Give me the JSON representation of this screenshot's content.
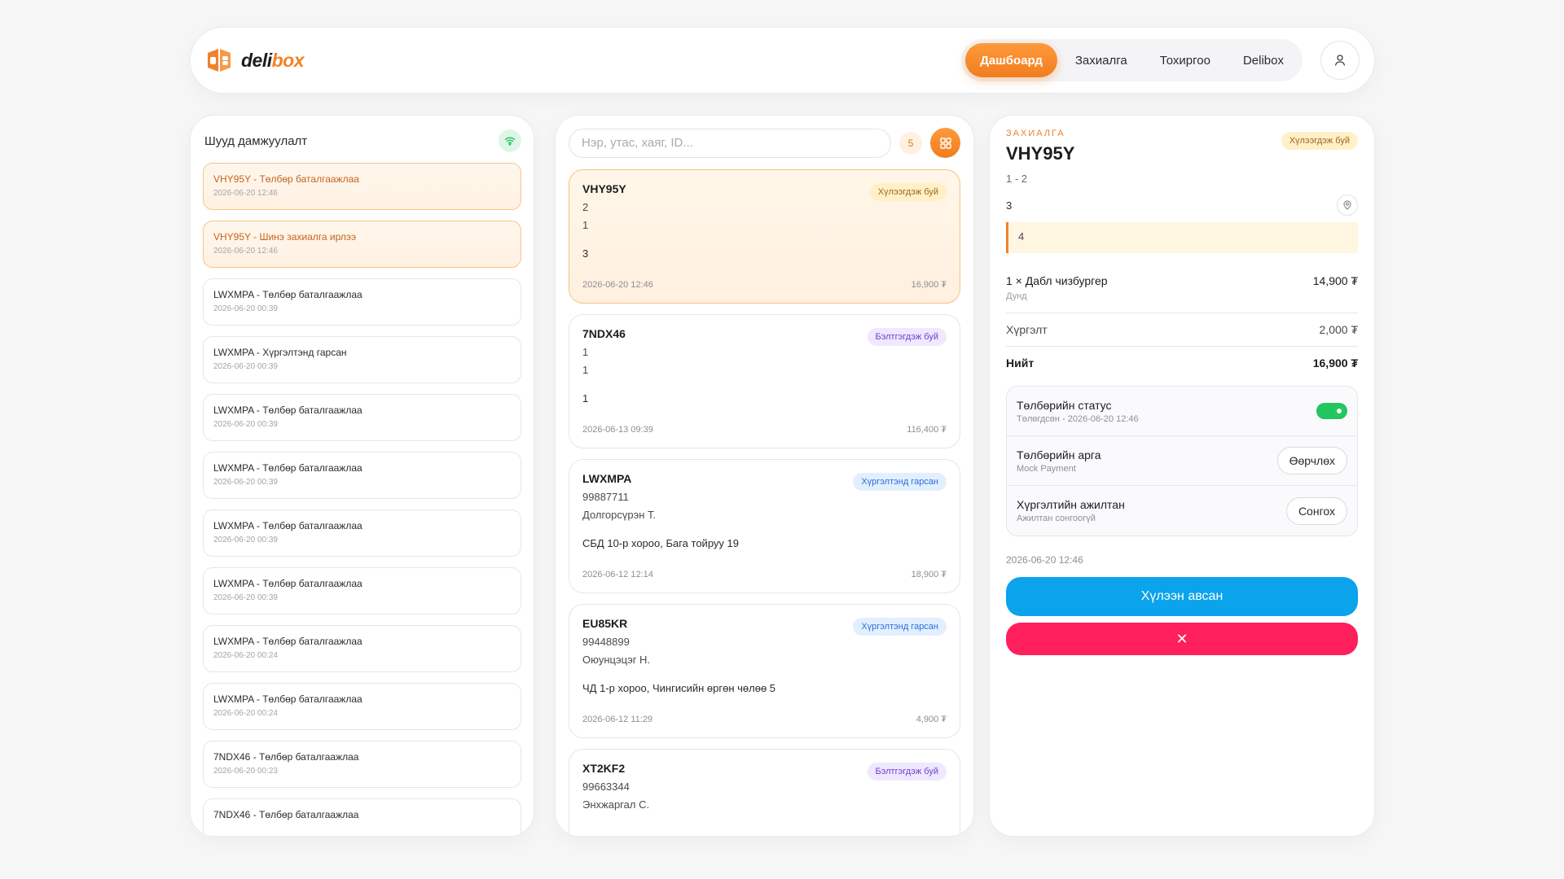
{
  "brand": {
    "name_a": "deli",
    "name_b": "box"
  },
  "nav": {
    "tabs": [
      "Дашбоард",
      "Захиалга",
      "Тохиргоо",
      "Delibox"
    ]
  },
  "feed": {
    "title": "Шууд дамжуулалт",
    "items": [
      {
        "text": "VHY95Y - Төлбөр баталгаажлаа",
        "time": "2026-06-20 12:46",
        "highlight": true
      },
      {
        "text": "VHY95Y - Шинэ захиалга ирлээ",
        "time": "2026-06-20 12:46",
        "highlight": true
      },
      {
        "text": "LWXMPA - Төлбөр баталгаажлаа",
        "time": "2026-06-20 00:39"
      },
      {
        "text": "LWXMPA - Хүргэлтэнд гарсан",
        "time": "2026-06-20 00:39"
      },
      {
        "text": "LWXMPA - Төлбөр баталгаажлаа",
        "time": "2026-06-20 00:39"
      },
      {
        "text": "LWXMPA - Төлбөр баталгаажлаа",
        "time": "2026-06-20 00:39"
      },
      {
        "text": "LWXMPA - Төлбөр баталгаажлаа",
        "time": "2026-06-20 00:39"
      },
      {
        "text": "LWXMPA - Төлбөр баталгаажлаа",
        "time": "2026-06-20 00:39"
      },
      {
        "text": "LWXMPA - Төлбөр баталгаажлаа",
        "time": "2026-06-20 00:24"
      },
      {
        "text": "LWXMPA - Төлбөр баталгаажлаа",
        "time": "2026-06-20 00:24"
      },
      {
        "text": "7NDX46 - Төлбөр баталгаажлаа",
        "time": "2026-06-20 00:23"
      },
      {
        "text": "7NDX46 - Төлбөр баталгаажлаа",
        "time": ""
      }
    ]
  },
  "orders": {
    "search_placeholder": "Нэр, утас, хаяг, ID...",
    "count": "5",
    "list": [
      {
        "code": "VHY95Y",
        "status": "Хүлээгдэж буй",
        "status_kind": "wait",
        "l1": "2",
        "l2": "1",
        "addr": "3",
        "time": "2026-06-20 12:46",
        "total": "16,900 ₮",
        "selected": true
      },
      {
        "code": "7NDX46",
        "status": "Бэлтгэгдэж буй",
        "status_kind": "prep",
        "l1": "1",
        "l2": "1",
        "addr": "1",
        "time": "2026-06-13 09:39",
        "total": "116,400 ₮"
      },
      {
        "code": "LWXMPA",
        "status": "Хүргэлтэнд гарсан",
        "status_kind": "done",
        "l1": "99887711",
        "l2": "Долгорсүрэн Т.",
        "addr": "СБД 10-р хороо, Бага тойруу 19",
        "time": "2026-06-12 12:14",
        "total": "18,900 ₮"
      },
      {
        "code": "EU85KR",
        "status": "Хүргэлтэнд гарсан",
        "status_kind": "done",
        "l1": "99448899",
        "l2": "Оюунцэцэг Н.",
        "addr": "ЧД 1-р хороо, Чингисийн өргөн чөлөө 5",
        "time": "2026-06-12 11:29",
        "total": "4,900 ₮"
      },
      {
        "code": "XT2KF2",
        "status": "Бэлтгэгдэж буй",
        "status_kind": "prep",
        "l1": "99663344",
        "l2": "Энхжаргал С.",
        "addr": "",
        "time": "",
        "total": ""
      }
    ]
  },
  "detail": {
    "label": "ЗАХИАЛГА",
    "code": "VHY95Y",
    "status": "Хүлээгдэж буй",
    "sub": "1 - 2",
    "addr": "3",
    "note": "4",
    "item_name": "1 × Дабл чизбургер",
    "item_price": "14,900 ₮",
    "item_size": "Дунд",
    "delivery_label": "Хүргэлт",
    "delivery_value": "2,000 ₮",
    "total_label": "Нийт",
    "total_value": "16,900 ₮",
    "pay_status_title": "Төлбөрийн статус",
    "pay_status_sub": "Төлөгдсөн - 2026-06-20 12:46",
    "pay_method_title": "Төлбөрийн арга",
    "pay_method_sub": "Mock Payment",
    "pay_method_btn": "Өөрчлөх",
    "courier_title": "Хүргэлтийн ажилтан",
    "courier_sub": "Ажилтан сонгоогүй",
    "courier_btn": "Сонгох",
    "time": "2026-06-20 12:46",
    "accept_btn": "Хүлээн авсан",
    "cancel_btn": "✕"
  },
  "colors": {
    "accent": "#f0822a",
    "blue": "#0aa3ec",
    "red": "#ff1f5a",
    "green": "#22c55e"
  }
}
